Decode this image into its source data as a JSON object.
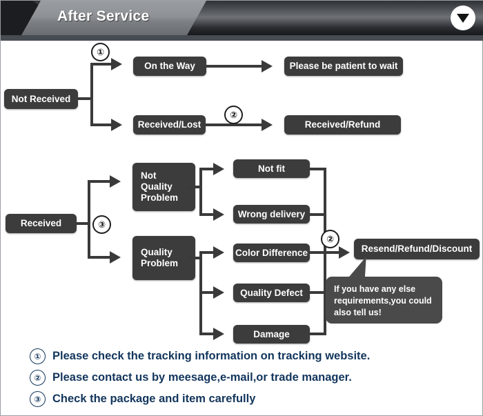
{
  "header": {
    "title": "After Service",
    "collapse_icon": "triangle-down-icon"
  },
  "flow_top": {
    "root": "Not Received",
    "branch_a": {
      "step": "On the Way",
      "result": "Please be patient to wait",
      "marker": "①"
    },
    "branch_b": {
      "step": "Received/Lost",
      "result": "Received/Refund",
      "marker": "②"
    }
  },
  "flow_bottom": {
    "root": "Received",
    "marker": "③",
    "merge_marker": "②",
    "group_a": {
      "label": "Not\nQuality\nProblem",
      "items": [
        "Not fit",
        "Wrong delivery"
      ]
    },
    "group_b": {
      "label": "Quality\nProblem",
      "items": [
        "Color Difference",
        "Quality Defect",
        "Damage"
      ]
    },
    "outcome": "Resend/Refund/Discount",
    "bubble": "If you have any else requirements,you could also tell us!"
  },
  "notes": [
    {
      "marker": "①",
      "text": "Please check the tracking information on tracking website."
    },
    {
      "marker": "②",
      "text": "Please contact us by meesage,e-mail,or trade manager."
    },
    {
      "marker": "③",
      "text": "Check the package and item carefully"
    }
  ],
  "colors": {
    "box_fill": "#3c3c3c",
    "bubble_fill": "#4a4a4a",
    "connector": "#3a3a3a",
    "note_text": "#12355c",
    "header_ribbon": "#8e9195"
  }
}
